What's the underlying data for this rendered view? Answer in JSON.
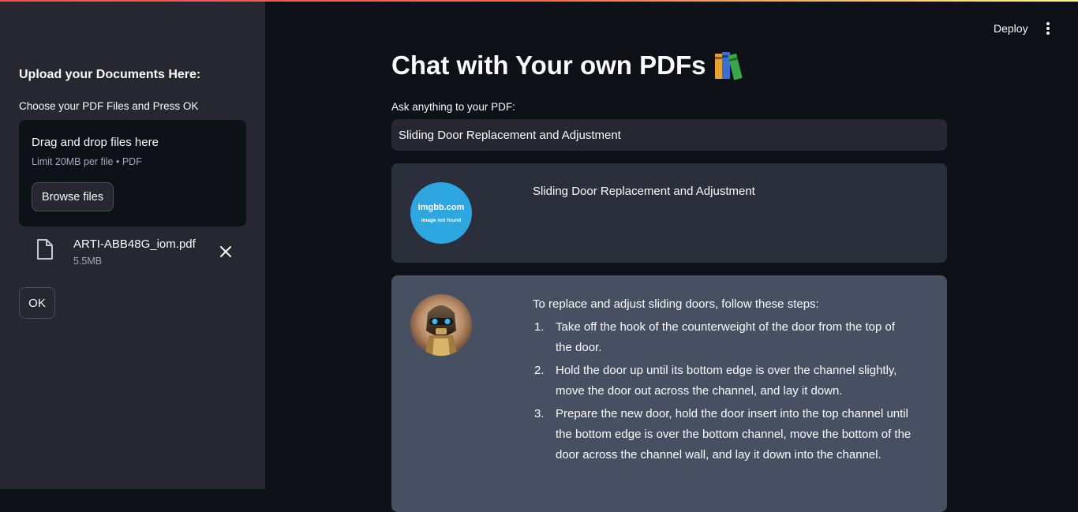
{
  "colors": {
    "accent_gradient_start": "#ff4b4b",
    "accent_gradient_end": "#fffd80",
    "background": "#0e1117",
    "sidebar": "#262730",
    "user_message_bg": "#2b2f3b",
    "bot_message_bg": "#475063",
    "user_avatar": "#2ea7e0"
  },
  "header": {
    "deploy_label": "Deploy",
    "menu_icon": "vertical-ellipsis-icon"
  },
  "sidebar": {
    "title": "Upload your Documents Here:",
    "subtitle": "Choose your PDF Files and Press OK",
    "dropzone": {
      "title": "Drag and drop files here",
      "limit": "Limit 20MB per file • PDF",
      "browse_label": "Browse files"
    },
    "file": {
      "name": "ARTI-ABB48G_iom.pdf",
      "size": "5.5MB",
      "icon": "file-icon"
    },
    "ok_label": "OK"
  },
  "main": {
    "title": "Chat with Your own PDFs",
    "title_icon": "books-emoji-icon",
    "input_label": "Ask anything to your PDF:",
    "input_value": "Sliding Door Replacement and Adjustment",
    "messages": {
      "user": {
        "avatar_line1": "imgbb.com",
        "avatar_line2": "image not found",
        "text": "Sliding Door Replacement and Adjustment"
      },
      "bot": {
        "avatar_icon": "robot-avatar-icon",
        "intro": "To replace and adjust sliding doors, follow these steps:",
        "steps": [
          {
            "num": "1.",
            "text": "Take off the hook of the counterweight of the door from the top of the door."
          },
          {
            "num": "2.",
            "text": "Hold the door up until its bottom edge is over the channel slightly, move the door out across the channel, and lay it down."
          },
          {
            "num": "3.",
            "text": "Prepare the new door, hold the door insert into the top channel until the bottom edge is over the bottom channel, move the bottom of the door across the channel wall, and lay it down into the channel."
          }
        ]
      }
    }
  }
}
